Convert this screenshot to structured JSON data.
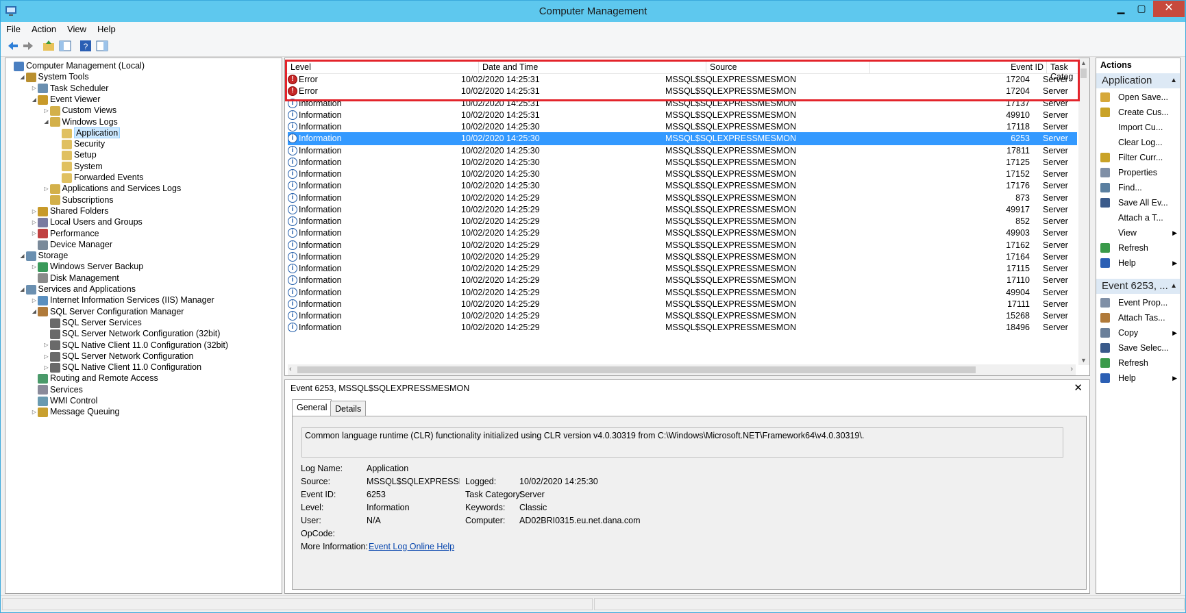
{
  "window": {
    "title": "Computer Management"
  },
  "menu": [
    "File",
    "Action",
    "View",
    "Help"
  ],
  "tree": [
    {
      "label": "Computer Management (Local)",
      "level": 0,
      "exp": ""
    },
    {
      "label": "System Tools",
      "level": 1,
      "exp": "◢"
    },
    {
      "label": "Task Scheduler",
      "level": 2,
      "exp": "▷"
    },
    {
      "label": "Event Viewer",
      "level": 2,
      "exp": "◢"
    },
    {
      "label": "Custom Views",
      "level": 3,
      "exp": "▷"
    },
    {
      "label": "Windows Logs",
      "level": 3,
      "exp": "◢"
    },
    {
      "label": "Application",
      "level": 4,
      "exp": "",
      "selected": true
    },
    {
      "label": "Security",
      "level": 4,
      "exp": ""
    },
    {
      "label": "Setup",
      "level": 4,
      "exp": ""
    },
    {
      "label": "System",
      "level": 4,
      "exp": ""
    },
    {
      "label": "Forwarded Events",
      "level": 4,
      "exp": ""
    },
    {
      "label": "Applications and Services Logs",
      "level": 3,
      "exp": "▷"
    },
    {
      "label": "Subscriptions",
      "level": 3,
      "exp": ""
    },
    {
      "label": "Shared Folders",
      "level": 2,
      "exp": "▷"
    },
    {
      "label": "Local Users and Groups",
      "level": 2,
      "exp": "▷"
    },
    {
      "label": "Performance",
      "level": 2,
      "exp": "▷"
    },
    {
      "label": "Device Manager",
      "level": 2,
      "exp": ""
    },
    {
      "label": "Storage",
      "level": 1,
      "exp": "◢"
    },
    {
      "label": "Windows Server Backup",
      "level": 2,
      "exp": "▷"
    },
    {
      "label": "Disk Management",
      "level": 2,
      "exp": ""
    },
    {
      "label": "Services and Applications",
      "level": 1,
      "exp": "◢"
    },
    {
      "label": "Internet Information Services (IIS) Manager",
      "level": 2,
      "exp": "▷"
    },
    {
      "label": "SQL Server Configuration Manager",
      "level": 2,
      "exp": "◢"
    },
    {
      "label": "SQL Server Services",
      "level": 3,
      "exp": ""
    },
    {
      "label": "SQL Server Network Configuration (32bit)",
      "level": 3,
      "exp": ""
    },
    {
      "label": "SQL Native Client 11.0 Configuration (32bit)",
      "level": 3,
      "exp": "▷"
    },
    {
      "label": "SQL Server Network Configuration",
      "level": 3,
      "exp": "▷"
    },
    {
      "label": "SQL Native Client 11.0 Configuration",
      "level": 3,
      "exp": "▷"
    },
    {
      "label": "Routing and Remote Access",
      "level": 2,
      "exp": ""
    },
    {
      "label": "Services",
      "level": 2,
      "exp": ""
    },
    {
      "label": "WMI Control",
      "level": 2,
      "exp": ""
    },
    {
      "label": "Message Queuing",
      "level": 2,
      "exp": "▷"
    }
  ],
  "columns": {
    "level": "Level",
    "datetime": "Date and Time",
    "source": "Source",
    "eventid": "Event ID",
    "task": "Task Categ"
  },
  "events": [
    {
      "level": "Error",
      "type": "error",
      "datetime": "10/02/2020 14:25:31",
      "source": "MSSQL$SQLEXPRESSMESMON",
      "eventid": "17204",
      "task": "Server"
    },
    {
      "level": "Error",
      "type": "error",
      "datetime": "10/02/2020 14:25:31",
      "source": "MSSQL$SQLEXPRESSMESMON",
      "eventid": "17204",
      "task": "Server"
    },
    {
      "level": "Information",
      "type": "info",
      "datetime": "10/02/2020 14:25:31",
      "source": "MSSQL$SQLEXPRESSMESMON",
      "eventid": "17137",
      "task": "Server"
    },
    {
      "level": "Information",
      "type": "info",
      "datetime": "10/02/2020 14:25:31",
      "source": "MSSQL$SQLEXPRESSMESMON",
      "eventid": "49910",
      "task": "Server"
    },
    {
      "level": "Information",
      "type": "info",
      "datetime": "10/02/2020 14:25:30",
      "source": "MSSQL$SQLEXPRESSMESMON",
      "eventid": "17118",
      "task": "Server"
    },
    {
      "level": "Information",
      "type": "info",
      "datetime": "10/02/2020 14:25:30",
      "source": "MSSQL$SQLEXPRESSMESMON",
      "eventid": "6253",
      "task": "Server",
      "selected": true
    },
    {
      "level": "Information",
      "type": "info",
      "datetime": "10/02/2020 14:25:30",
      "source": "MSSQL$SQLEXPRESSMESMON",
      "eventid": "17811",
      "task": "Server"
    },
    {
      "level": "Information",
      "type": "info",
      "datetime": "10/02/2020 14:25:30",
      "source": "MSSQL$SQLEXPRESSMESMON",
      "eventid": "17125",
      "task": "Server"
    },
    {
      "level": "Information",
      "type": "info",
      "datetime": "10/02/2020 14:25:30",
      "source": "MSSQL$SQLEXPRESSMESMON",
      "eventid": "17152",
      "task": "Server"
    },
    {
      "level": "Information",
      "type": "info",
      "datetime": "10/02/2020 14:25:30",
      "source": "MSSQL$SQLEXPRESSMESMON",
      "eventid": "17176",
      "task": "Server"
    },
    {
      "level": "Information",
      "type": "info",
      "datetime": "10/02/2020 14:25:29",
      "source": "MSSQL$SQLEXPRESSMESMON",
      "eventid": "873",
      "task": "Server"
    },
    {
      "level": "Information",
      "type": "info",
      "datetime": "10/02/2020 14:25:29",
      "source": "MSSQL$SQLEXPRESSMESMON",
      "eventid": "49917",
      "task": "Server"
    },
    {
      "level": "Information",
      "type": "info",
      "datetime": "10/02/2020 14:25:29",
      "source": "MSSQL$SQLEXPRESSMESMON",
      "eventid": "852",
      "task": "Server"
    },
    {
      "level": "Information",
      "type": "info",
      "datetime": "10/02/2020 14:25:29",
      "source": "MSSQL$SQLEXPRESSMESMON",
      "eventid": "49903",
      "task": "Server"
    },
    {
      "level": "Information",
      "type": "info",
      "datetime": "10/02/2020 14:25:29",
      "source": "MSSQL$SQLEXPRESSMESMON",
      "eventid": "17162",
      "task": "Server"
    },
    {
      "level": "Information",
      "type": "info",
      "datetime": "10/02/2020 14:25:29",
      "source": "MSSQL$SQLEXPRESSMESMON",
      "eventid": "17164",
      "task": "Server"
    },
    {
      "level": "Information",
      "type": "info",
      "datetime": "10/02/2020 14:25:29",
      "source": "MSSQL$SQLEXPRESSMESMON",
      "eventid": "17115",
      "task": "Server"
    },
    {
      "level": "Information",
      "type": "info",
      "datetime": "10/02/2020 14:25:29",
      "source": "MSSQL$SQLEXPRESSMESMON",
      "eventid": "17110",
      "task": "Server"
    },
    {
      "level": "Information",
      "type": "info",
      "datetime": "10/02/2020 14:25:29",
      "source": "MSSQL$SQLEXPRESSMESMON",
      "eventid": "49904",
      "task": "Server"
    },
    {
      "level": "Information",
      "type": "info",
      "datetime": "10/02/2020 14:25:29",
      "source": "MSSQL$SQLEXPRESSMESMON",
      "eventid": "17111",
      "task": "Server"
    },
    {
      "level": "Information",
      "type": "info",
      "datetime": "10/02/2020 14:25:29",
      "source": "MSSQL$SQLEXPRESSMESMON",
      "eventid": "15268",
      "task": "Server"
    },
    {
      "level": "Information",
      "type": "info",
      "datetime": "10/02/2020 14:25:29",
      "source": "MSSQL$SQLEXPRESSMESMON",
      "eventid": "18496",
      "task": "Server"
    }
  ],
  "detail": {
    "title": "Event 6253, MSSQL$SQLEXPRESSMESMON",
    "tabs": [
      "General",
      "Details"
    ],
    "message": "Common language runtime (CLR) functionality initialized using CLR version v4.0.30319 from C:\\Windows\\Microsoft.NET\\Framework64\\v4.0.30319\\.",
    "labels": {
      "logname": "Log Name:",
      "source": "Source:",
      "eventid": "Event ID:",
      "level": "Level:",
      "user": "User:",
      "opcode": "OpCode:",
      "moreinfo": "More Information:",
      "logged": "Logged:",
      "taskcat": "Task Category:",
      "keywords": "Keywords:",
      "computer": "Computer:"
    },
    "values": {
      "logname": "Application",
      "source": "MSSQL$SQLEXPRESSMESMC",
      "eventid": "6253",
      "level": "Information",
      "user": "N/A",
      "opcode": "",
      "logged": "10/02/2020 14:25:30",
      "taskcat": "Server",
      "keywords": "Classic",
      "computer": "AD02BRI0315.eu.net.dana.com"
    },
    "link": "Event Log Online Help"
  },
  "actions": {
    "header": "Actions",
    "section1": "Application",
    "items1": [
      {
        "label": "Open Save...",
        "icon": "open-folder-icon"
      },
      {
        "label": "Create Cus...",
        "icon": "filter-icon"
      },
      {
        "label": "Import Cu...",
        "icon": ""
      },
      {
        "label": "Clear Log...",
        "icon": ""
      },
      {
        "label": "Filter Curr...",
        "icon": "filter-icon"
      },
      {
        "label": "Properties",
        "icon": "properties-icon"
      },
      {
        "label": "Find...",
        "icon": "find-icon"
      },
      {
        "label": "Save All Ev...",
        "icon": "save-icon"
      },
      {
        "label": "Attach a T...",
        "icon": ""
      },
      {
        "label": "View",
        "icon": "",
        "submenu": true
      },
      {
        "label": "Refresh",
        "icon": "refresh-icon"
      },
      {
        "label": "Help",
        "icon": "help-icon",
        "submenu": true
      }
    ],
    "section2": "Event 6253, ...",
    "items2": [
      {
        "label": "Event Prop...",
        "icon": "properties-icon"
      },
      {
        "label": "Attach Tas...",
        "icon": "task-icon"
      },
      {
        "label": "Copy",
        "icon": "copy-icon",
        "submenu": true
      },
      {
        "label": "Save Selec...",
        "icon": "save-icon"
      },
      {
        "label": "Refresh",
        "icon": "refresh-icon"
      },
      {
        "label": "Help",
        "icon": "help-icon",
        "submenu": true
      }
    ]
  }
}
